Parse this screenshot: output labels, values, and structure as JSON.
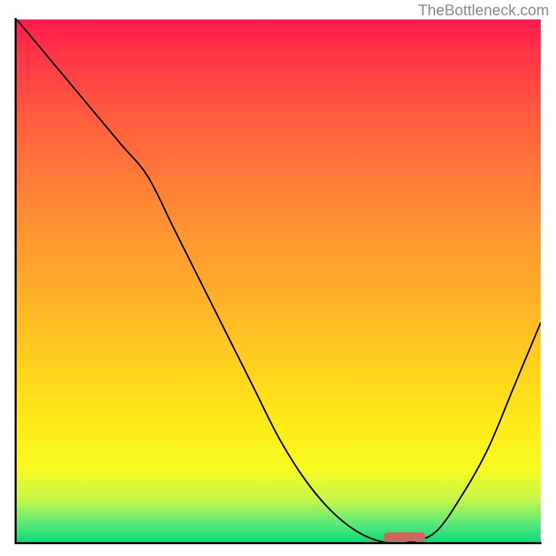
{
  "watermark": "TheBottleneck.com",
  "chart_data": {
    "type": "line",
    "title": "",
    "xlabel": "",
    "ylabel": "",
    "xlim": [
      0,
      100
    ],
    "ylim": [
      0,
      100
    ],
    "grid": false,
    "legend": false,
    "background": {
      "gradient_stops": [
        {
          "pos": 0,
          "color": "#ff1a4c"
        },
        {
          "pos": 6,
          "color": "#ff3348"
        },
        {
          "pos": 18,
          "color": "#ff5a3f"
        },
        {
          "pos": 30,
          "color": "#ff7a38"
        },
        {
          "pos": 42,
          "color": "#ff9830"
        },
        {
          "pos": 54,
          "color": "#ffb228"
        },
        {
          "pos": 66,
          "color": "#ffd11f"
        },
        {
          "pos": 78,
          "color": "#fdec18"
        },
        {
          "pos": 86,
          "color": "#f7fb22"
        },
        {
          "pos": 92,
          "color": "#c4f74c"
        },
        {
          "pos": 97,
          "color": "#4ee77d"
        },
        {
          "pos": 100,
          "color": "#09db71"
        }
      ]
    },
    "curve": {
      "x": [
        0,
        5,
        10,
        15,
        20,
        25,
        30,
        35,
        40,
        45,
        50,
        55,
        60,
        65,
        70,
        75,
        80,
        85,
        90,
        95,
        100
      ],
      "y": [
        100,
        94,
        88,
        82,
        76,
        70,
        60,
        50,
        40,
        30,
        20,
        12,
        6,
        2,
        0,
        0,
        2,
        9,
        18,
        30,
        42
      ]
    },
    "optimal_region": {
      "x_start": 70,
      "x_end": 78,
      "color": "#d4635b"
    }
  }
}
